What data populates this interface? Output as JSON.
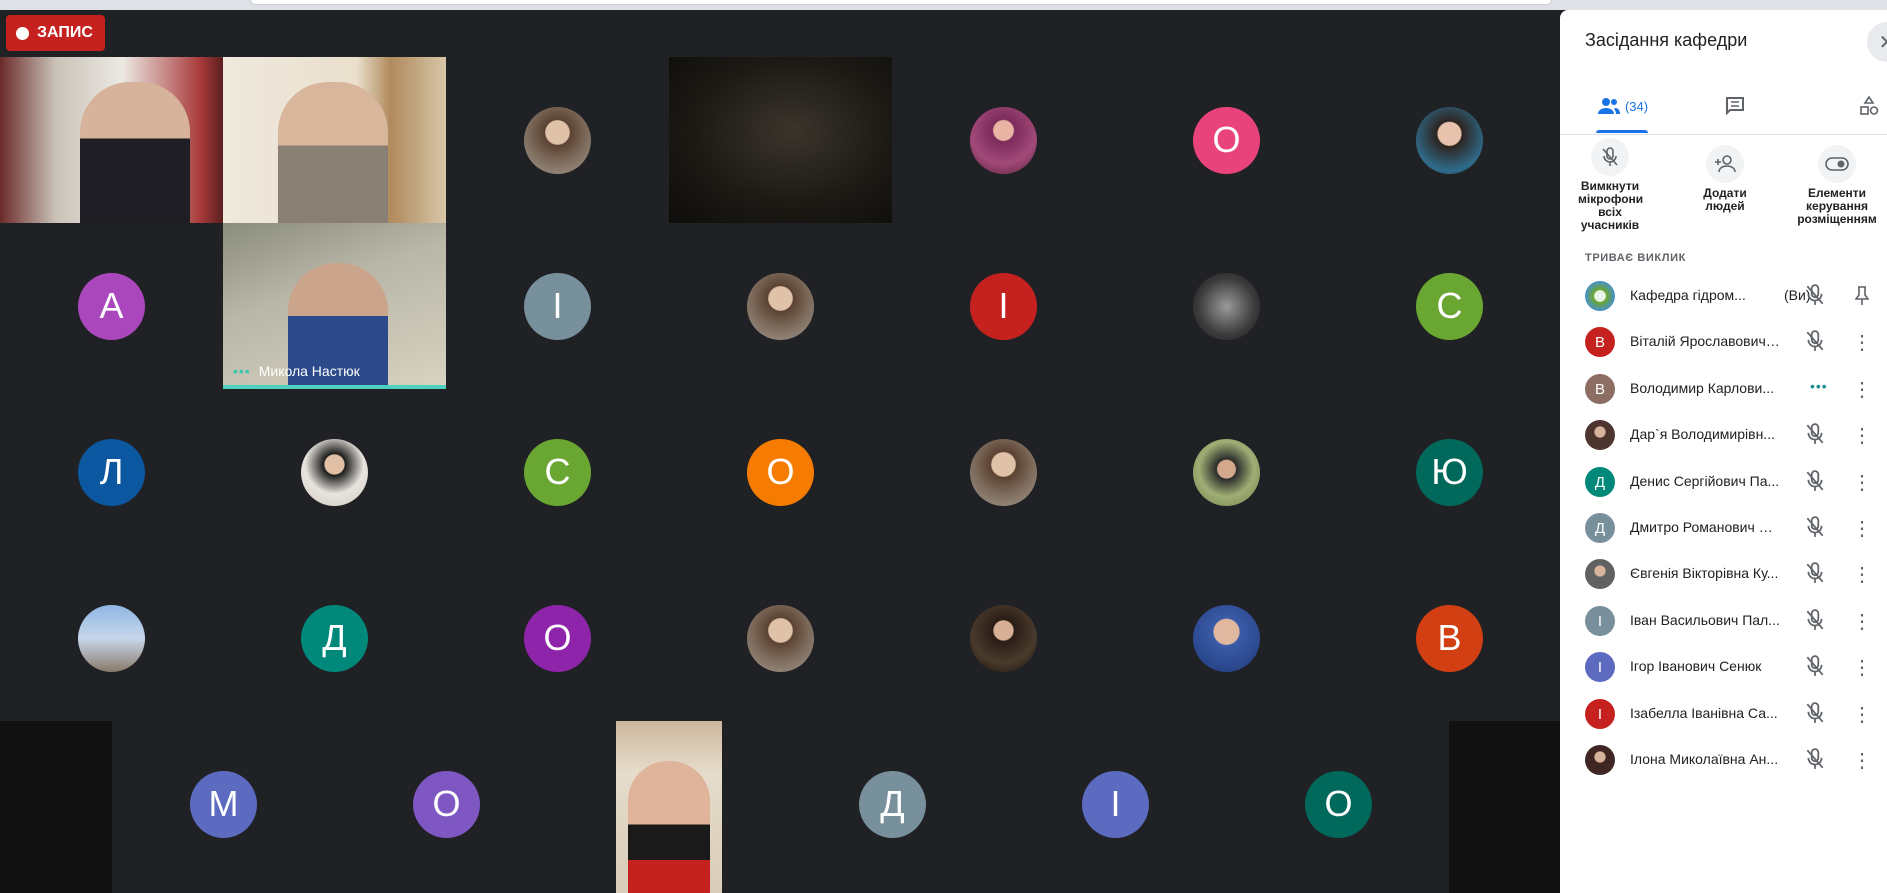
{
  "recording": {
    "label": "ЗАПИС"
  },
  "video_tiles": {
    "mykola": {
      "name": "Микола Настюк"
    }
  },
  "grid_letters": {
    "r1c7": "O",
    "r2c1": "А",
    "r2c3": "І",
    "r2c5": "І",
    "r2c7": "С",
    "r3c1": "Л",
    "r3c3": "С",
    "r3c4": "О",
    "r3c7": "Ю",
    "r4c2": "Д",
    "r4c3": "О",
    "r4c7": "В",
    "r5c1": "М",
    "r5c2": "О",
    "r5c4": "Д",
    "r5c5": "І",
    "r5c6": "О"
  },
  "colors": {
    "pink": "#e8437a",
    "purple": "#ab47bc",
    "grey": "#78909c",
    "red": "#c5221f",
    "green": "#6aa632",
    "blue": "#0b57a0",
    "orange": "#f57c00",
    "teal": "#00897b",
    "deep_purple": "#8e24aa",
    "orange_red": "#d23f12",
    "indigo": "#5c6bc0",
    "violet": "#7e57c2",
    "dark_teal": "#00695c",
    "brown": "#8d6e63"
  },
  "panel": {
    "title": "Засідання кафедри",
    "tabs": {
      "people_count": "(34)"
    },
    "actions": {
      "mute_all": "Вимкнути мікрофони всіх учасників",
      "add_people": "Додати людей",
      "host_controls": "Елементи керування розміщенням"
    },
    "section": "ТРИВАЄ ВИКЛИК",
    "participants": [
      {
        "initial": "",
        "name": "Кафедра гідром...",
        "you": "(Ви)",
        "color": "#8bc34a"
      },
      {
        "initial": "В",
        "name": "Віталій Ярославович ...",
        "color": "#c5221f"
      },
      {
        "initial": "В",
        "name": "Володимир Карлови...",
        "color": "#8d6e63"
      },
      {
        "initial": "",
        "name": "Дар`я Володимирівн...",
        "color": "#4e342e"
      },
      {
        "initial": "Д",
        "name": "Денис Сергійович Па...",
        "color": "#00897b"
      },
      {
        "initial": "Д",
        "name": "Дмитро Романович П...",
        "color": "#78909c"
      },
      {
        "initial": "",
        "name": "Євгенія Вікторівна Ку...",
        "color": "#616161"
      },
      {
        "initial": "І",
        "name": "Іван Васильович Пал...",
        "color": "#78909c"
      },
      {
        "initial": "І",
        "name": "Ігор Іванович Сенюк",
        "color": "#5c6bc0"
      },
      {
        "initial": "І",
        "name": "Ізабелла Іванівна Са...",
        "color": "#c5221f"
      },
      {
        "initial": "",
        "name": "Ілона Миколаївна Ан...",
        "color": "#3e2723"
      }
    ]
  }
}
